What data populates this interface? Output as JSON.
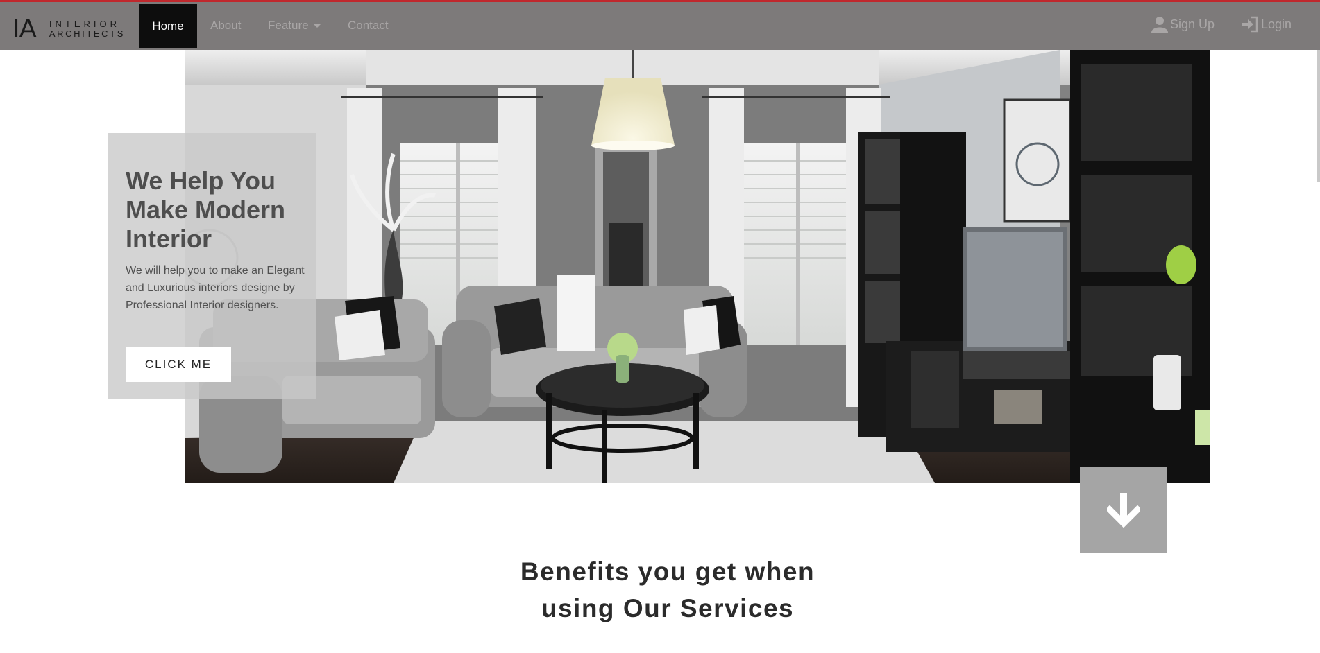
{
  "brand": {
    "mark": "IA",
    "line1": "INTERIOR",
    "line2": "ARCHITECTS"
  },
  "nav": {
    "home": "Home",
    "about": "About",
    "feature": "Feature",
    "contact": "Contact",
    "signup": "Sign Up",
    "login": "Login"
  },
  "hero": {
    "title": "We Help You Make Modern Interior",
    "text": "We will help you to make an Elegant and Luxurious interiors designe by Professional Interior designers.",
    "button": "CLICK ME"
  },
  "benefits": {
    "heading": "Benefits you get when using Our Services"
  },
  "colors": {
    "navbar": "#7d7a7a",
    "accent_line": "#c0282d",
    "active_nav": "#0d0d0d",
    "down_button": "#a5a5a5"
  },
  "icons": {
    "signup": "user-icon",
    "login": "sign-in-icon",
    "down": "arrow-down-icon"
  }
}
